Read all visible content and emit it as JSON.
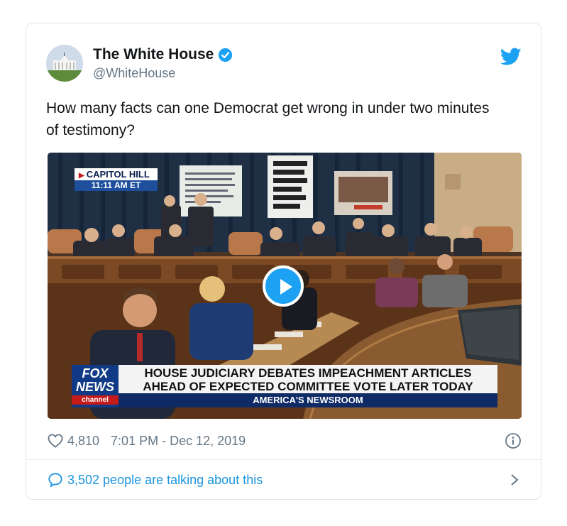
{
  "tweet": {
    "display_name": "The White House",
    "handle": "@WhiteHouse",
    "text": "How many facts can one Democrat get wrong in under two minutes of testimony?",
    "likes": "4,810",
    "timestamp": "7:01 PM - Dec 12, 2019",
    "conversation": "3,502 people are talking about this"
  },
  "video": {
    "bug_location": "CAPITOL HILL",
    "bug_time": "11:11 AM ET",
    "network_line1": "FOX",
    "network_line2": "NEWS",
    "network_line3": "channel",
    "headline_line1": "HOUSE JUDICIARY DEBATES IMPEACHMENT ARTICLES",
    "headline_line2": "AHEAD OF EXPECTED COMMITTEE VOTE LATER TODAY",
    "program": "AMERICA'S NEWSROOM",
    "sign_text": "IF THE SENATE DOES NOT CONVICT, THAT DOES NOT MEAN THAT IT'S OVER"
  },
  "colors": {
    "brand_blue": "#1da1f2",
    "link_blue": "#1b95e0",
    "text_dark": "#14171a",
    "text_gray": "#657786"
  },
  "icons": {
    "verified": "verified-badge-icon",
    "twitter": "twitter-bird-icon",
    "like": "heart-icon",
    "info": "info-icon",
    "reply": "chat-bubble-icon",
    "chevron": "chevron-right-icon",
    "play": "play-icon"
  }
}
